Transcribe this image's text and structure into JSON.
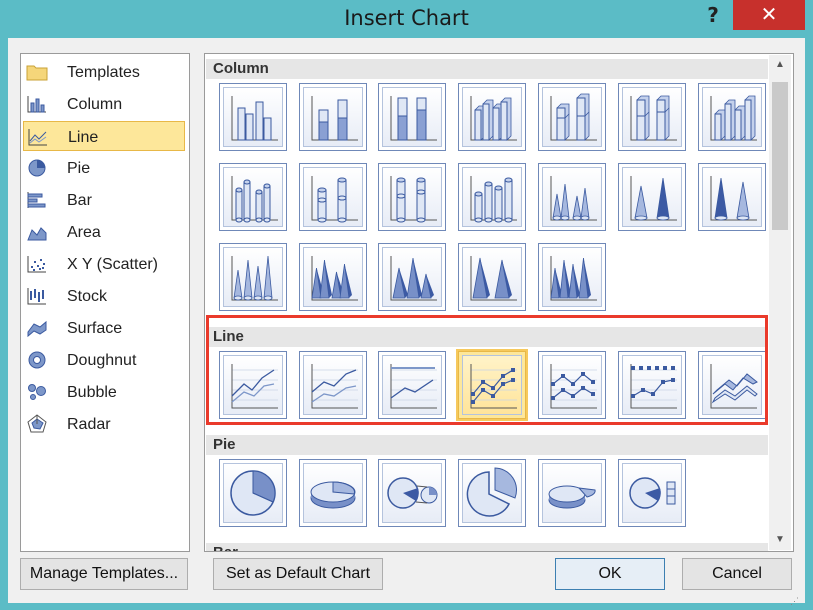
{
  "window": {
    "title": "Insert Chart",
    "help_label": "?",
    "close_label": "✕"
  },
  "categories": [
    {
      "label": "Templates",
      "icon": "folder-icon",
      "selected": false
    },
    {
      "label": "Column",
      "icon": "column-chart-icon",
      "selected": false
    },
    {
      "label": "Line",
      "icon": "line-chart-icon",
      "selected": true
    },
    {
      "label": "Pie",
      "icon": "pie-chart-icon",
      "selected": false
    },
    {
      "label": "Bar",
      "icon": "bar-chart-icon",
      "selected": false
    },
    {
      "label": "Area",
      "icon": "area-chart-icon",
      "selected": false
    },
    {
      "label": "X Y (Scatter)",
      "icon": "scatter-chart-icon",
      "selected": false
    },
    {
      "label": "Stock",
      "icon": "stock-chart-icon",
      "selected": false
    },
    {
      "label": "Surface",
      "icon": "surface-chart-icon",
      "selected": false
    },
    {
      "label": "Doughnut",
      "icon": "doughnut-chart-icon",
      "selected": false
    },
    {
      "label": "Bubble",
      "icon": "bubble-chart-icon",
      "selected": false
    },
    {
      "label": "Radar",
      "icon": "radar-chart-icon",
      "selected": false
    }
  ],
  "gallery": {
    "sections": [
      {
        "label": "Column",
        "thumbs": [
          "clustered-column",
          "stacked-column",
          "100-stacked-column",
          "3d-clustered-column",
          "3d-stacked-column",
          "3d-100-stacked-column",
          "3d-column",
          "clustered-cylinder",
          "stacked-cylinder",
          "100-stacked-cylinder",
          "3d-cylinder",
          "clustered-cone",
          "stacked-cone",
          "100-stacked-cone",
          "3d-cone",
          "clustered-pyramid",
          "stacked-pyramid",
          "100-stacked-pyramid",
          "3d-pyramid"
        ]
      },
      {
        "label": "Line",
        "thumbs": [
          "line",
          "stacked-line",
          "100-stacked-line",
          "line-with-markers",
          "stacked-line-with-markers",
          "100-stacked-line-with-markers",
          "3d-line"
        ],
        "selected_index": 3
      },
      {
        "label": "Pie",
        "thumbs": [
          "pie",
          "3d-pie",
          "pie-of-pie",
          "exploded-pie",
          "3d-exploded-pie",
          "bar-of-pie"
        ]
      },
      {
        "label": "Bar",
        "thumbs": []
      }
    ]
  },
  "buttons": {
    "manage_templates": "Manage Templates...",
    "set_default": "Set as Default Chart",
    "ok": "OK",
    "cancel": "Cancel"
  },
  "colors": {
    "highlight": "#ea3a2b",
    "selected": "#fde79a",
    "close": "#c7302c",
    "titlebar": "#5bbcc6"
  }
}
